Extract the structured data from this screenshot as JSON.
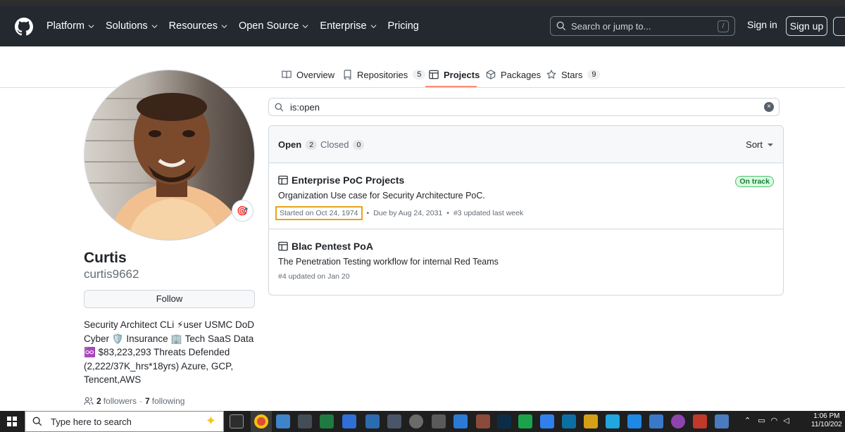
{
  "header": {
    "nav": [
      {
        "label": "Platform",
        "dropdown": true
      },
      {
        "label": "Solutions",
        "dropdown": true
      },
      {
        "label": "Resources",
        "dropdown": true
      },
      {
        "label": "Open Source",
        "dropdown": true
      },
      {
        "label": "Enterprise",
        "dropdown": true
      },
      {
        "label": "Pricing",
        "dropdown": false
      }
    ],
    "search_placeholder": "Search or jump to...",
    "search_key": "/",
    "sign_in": "Sign in",
    "sign_up": "Sign up"
  },
  "tabs": [
    {
      "label": "Overview",
      "icon": "book-icon"
    },
    {
      "label": "Repositories",
      "icon": "repo-icon",
      "count": "5"
    },
    {
      "label": "Projects",
      "icon": "table-icon",
      "active": true
    },
    {
      "label": "Packages",
      "icon": "package-icon"
    },
    {
      "label": "Stars",
      "icon": "star-icon",
      "count": "9"
    }
  ],
  "profile": {
    "name": "Curtis",
    "login": "curtis9662",
    "status_emoji": "🎯",
    "follow_label": "Follow",
    "bio_lines": [
      "Security Architect CLi ⚡user USMC DoD",
      "Cyber 🛡️ Insurance 🏢 Tech SaaS Data",
      "♾️ $83,223,293 Threats Defended",
      "(2,222/37K_hrs*18yrs) Azure, GCP,",
      "Tencent,AWS"
    ],
    "followers_count": "2",
    "followers_label": "followers",
    "separator": "·",
    "following_count": "7",
    "following_label": "following"
  },
  "projects": {
    "filter_value": "is:open",
    "open_label": "Open",
    "open_count": "2",
    "closed_label": "Closed",
    "closed_count": "0",
    "sort_label": "Sort",
    "items": [
      {
        "title": "Enterprise PoC Projects",
        "description": "Organization Use case for Security Architecture PoC.",
        "started": "Started on Oct 24, 1974",
        "due": "Due by Aug 24, 2031",
        "updated": "#3 updated last week",
        "status": "On track"
      },
      {
        "title": "Blac Pentest PoA",
        "description": "The Penetration Testing workflow for internal Red Teams",
        "updated": "#4 updated on Jan 20"
      }
    ]
  },
  "taskbar": {
    "search_placeholder": "Type here to search",
    "time": "1:06 PM",
    "date": "11/10/202"
  },
  "colors": {
    "header_bg": "#24292f",
    "tab_underline": "#fd8c73",
    "badge_green": "#1a7f37",
    "highlight_box": "#e8a317"
  }
}
